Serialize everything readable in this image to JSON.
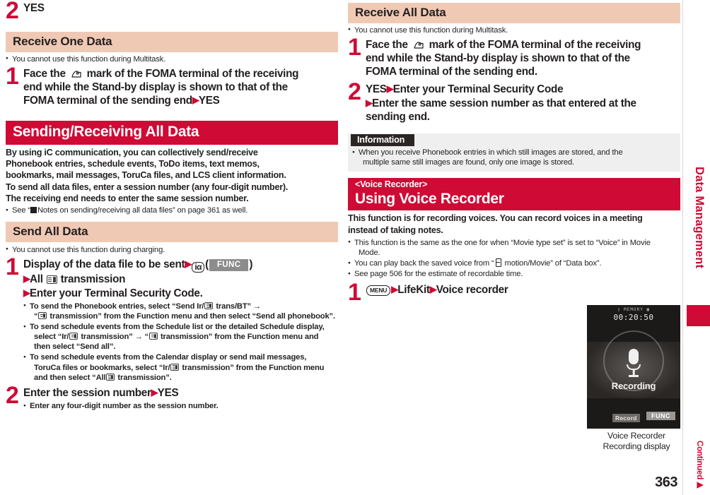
{
  "page": {
    "number": "363",
    "side_tab": "Data Management",
    "continued": "Continued▶"
  },
  "left_column": {
    "step_yes": {
      "num": "2",
      "text": "YES"
    },
    "receive_one_data": {
      "heading": "Receive One Data",
      "note": "You cannot use this function during Multitask.",
      "step": {
        "num": "1",
        "line1_a": "Face the",
        "line1_b": "mark of the FOMA terminal of the receiving",
        "line2": "end while the Stand-by display is shown to that of the",
        "line3": "FOMA terminal of the sending end",
        "line3_tail": "YES"
      }
    },
    "sending_receiving_all_data": {
      "heading": "Sending/Receiving All Data",
      "intro": [
        "By using iC communication, you can collectively send/receive",
        "Phonebook entries, schedule events, ToDo items, text memos,",
        "bookmarks, mail messages, ToruCa files, and LCS client information.",
        "To send all data files, enter a session number (any four-digit number).",
        "The receiving end needs to enter the same session number."
      ],
      "see_note_pre": "See “",
      "see_note_post": "Notes on sending/receiving all data files” on page 361 as well."
    },
    "send_all_data": {
      "heading": "Send All Data",
      "note": "You cannot use this function during charging.",
      "step1": {
        "num": "1",
        "line1": "Display of the data file to be sent",
        "func_label": "FUNC",
        "key_label": "iα",
        "line2_a": "All",
        "line2_b": "transmission",
        "line3": "Enter your Terminal Security Code.",
        "bullets": [
          {
            "parts": [
              "To send the Phonebook entries, select “Send Ir/",
              " trans/BT” →",
              "“",
              " transmission” from the Function menu and then select “Send all phonebook”."
            ]
          },
          {
            "parts": [
              "To send schedule events from the Schedule list or the detailed Schedule display,",
              "select “Ir/",
              " transmission” → “",
              " transmission” from the Function menu and",
              "then select “Send all”."
            ]
          },
          {
            "parts": [
              "To send schedule events from the Calendar display or send mail messages,",
              "ToruCa files or bookmarks, select “Ir/",
              " transmission” from the Function menu",
              "and then select “All",
              " transmission”."
            ]
          }
        ]
      },
      "step2": {
        "num": "2",
        "text": "Enter the session number",
        "tail": "YES",
        "note": "Enter any four-digit number as the session number."
      }
    }
  },
  "right_column": {
    "receive_all_data": {
      "heading": "Receive All Data",
      "note": "You cannot use this function during Multitask.",
      "step1": {
        "num": "1",
        "line1_a": "Face the",
        "line1_b": "mark of the FOMA terminal of the receiving",
        "line2": "end while the Stand-by display is shown to that of the",
        "line3": "FOMA terminal of the sending end."
      },
      "step2": {
        "num": "2",
        "line1_a": "YES",
        "line1_b": "Enter your Terminal Security Code",
        "line2": "Enter the same session number as that entered at the",
        "line3": "sending end."
      }
    },
    "information": {
      "tab_label": "Information",
      "bullet_line1": "When you receive Phonebook entries in which still images are stored, and the",
      "bullet_line2": "multiple same still images are found, only one image is stored."
    },
    "voice_recorder": {
      "eyebrow": "<Voice Recorder>",
      "title": "Using Voice Recorder",
      "intro": [
        "This function is for recording voices. You can record voices in a meeting",
        "instead of taking notes."
      ],
      "bullets": [
        {
          "line1": "This function is the same as the one for when “Movie type set” is set to “Voice” in Movie",
          "line2": "Mode."
        },
        {
          "pre": "You can play back the saved voice from “",
          "post": " motion/Movie” of “Data box”."
        },
        {
          "line1": "See page 506 for the estimate of recordable time."
        }
      ],
      "step1": {
        "num": "1",
        "key_label": "MENU",
        "item1": "LifeKit",
        "item2": "Voice recorder"
      }
    },
    "figure": {
      "status_icons": "▯ MEMORY ▣",
      "timer": "00:20:50",
      "recording_label": "Recording",
      "softkey_left": "Record",
      "softkey_right": "FUNC",
      "caption_line1": "Voice Recorder",
      "caption_line2": "Recording display"
    }
  },
  "colors": {
    "brand_red": "#cf0a35",
    "sub_heading_bg": "#f0c9b5",
    "info_bg": "#efefef",
    "text": "#231f20"
  }
}
